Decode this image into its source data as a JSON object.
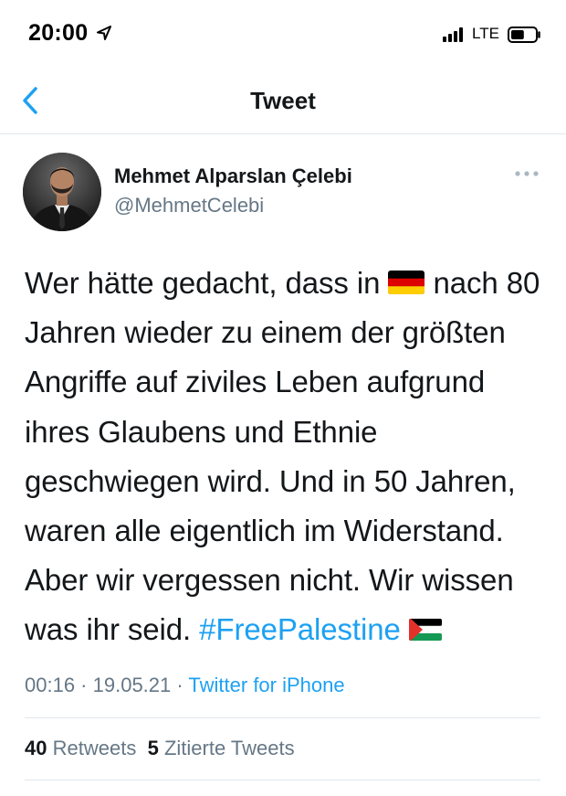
{
  "status_bar": {
    "time": "20:00",
    "network": "LTE",
    "signal_bars": 4,
    "battery_level": 0.55,
    "icons": [
      "location-arrow-icon",
      "signal-icon",
      "battery-icon"
    ]
  },
  "nav": {
    "title": "Tweet",
    "back_icon": "chevron-left-icon"
  },
  "author": {
    "name": "Mehmet Alparslan Çelebi",
    "handle": "@MehmetCelebi",
    "more_icon": "ellipsis-icon"
  },
  "tweet": {
    "text_part1": "Wer hätte gedacht, dass in ",
    "flag1": "germany-flag",
    "text_part2": " nach 80 Jahren wieder zu einem der größten Angriffe auf ziviles Leben aufgrund ihres Glaubens und Ethnie geschwiegen wird. Und in 50 Jahren, waren alle eigentlich im Widerstand. Aber wir vergessen nicht. Wir wissen was ihr seid. ",
    "hashtag": "#FreePalestine",
    "flag2": "palestine-flag"
  },
  "meta": {
    "time": "00:16",
    "separator1": " · ",
    "date": "19.05.21",
    "separator2": " · ",
    "source": "Twitter for iPhone"
  },
  "stats": {
    "retweets_count": "40",
    "retweets_label": "Retweets",
    "quotes_count": "5",
    "quotes_label": "Zitierte Tweets"
  },
  "colors": {
    "link_blue": "#1da1f2",
    "secondary_text": "#657786",
    "primary_text": "#14171a",
    "divider": "#e1e8ed"
  }
}
